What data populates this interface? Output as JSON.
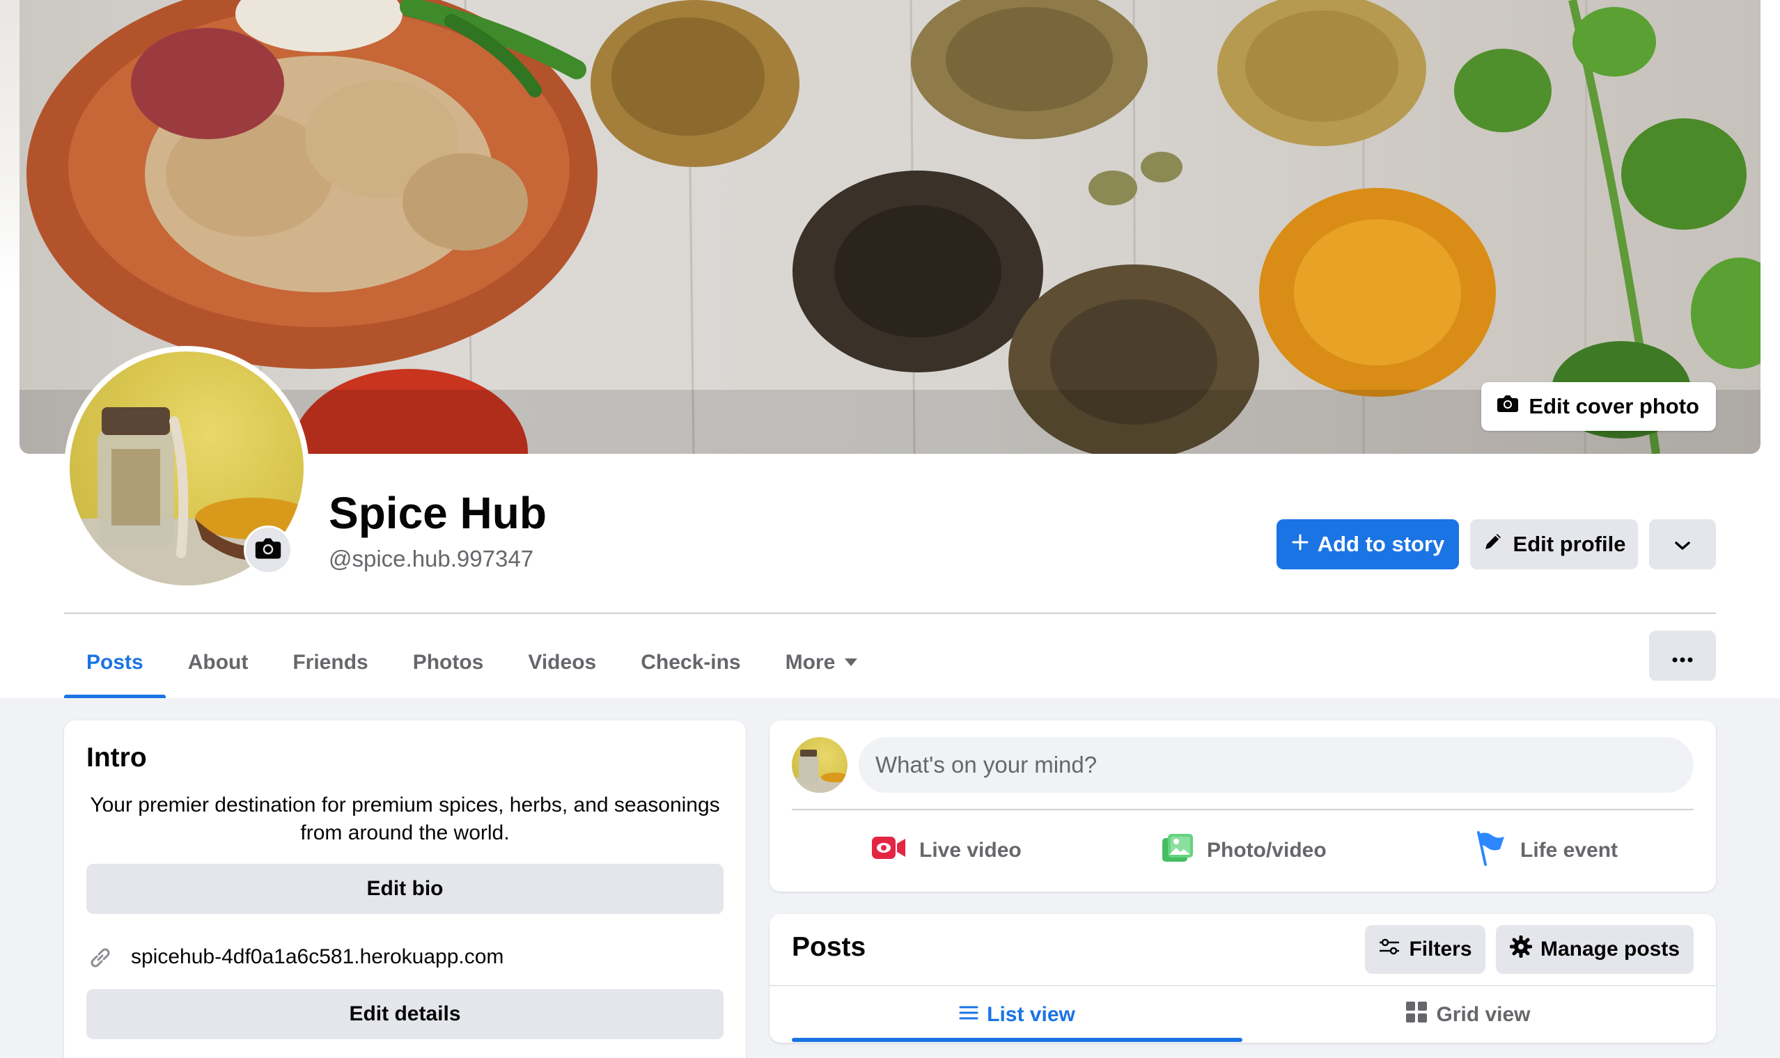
{
  "profile": {
    "name": "Spice Hub",
    "handle": "@spice.hub.997347",
    "edit_cover_label": "Edit cover photo"
  },
  "actions": {
    "add_to_story": "Add to story",
    "edit_profile": "Edit profile"
  },
  "tabs": [
    {
      "label": "Posts",
      "active": true
    },
    {
      "label": "About"
    },
    {
      "label": "Friends"
    },
    {
      "label": "Photos"
    },
    {
      "label": "Videos"
    },
    {
      "label": "Check-ins"
    },
    {
      "label": "More"
    }
  ],
  "intro": {
    "title": "Intro",
    "bio": "Your premier destination for premium spices, herbs, and seasonings from around the world.",
    "edit_bio": "Edit bio",
    "website": "spicehub-4df0a1a6c581.herokuapp.com",
    "edit_details": "Edit details"
  },
  "composer": {
    "placeholder": "What's on your mind?",
    "live_video": "Live video",
    "photo_video": "Photo/video",
    "life_event": "Life event"
  },
  "posts": {
    "title": "Posts",
    "filters": "Filters",
    "manage_posts": "Manage posts",
    "list_view": "List view",
    "grid_view": "Grid view"
  },
  "colors": {
    "accent": "#1b74e4",
    "background": "#f0f2f5",
    "button_gray": "#e4e6eb"
  }
}
